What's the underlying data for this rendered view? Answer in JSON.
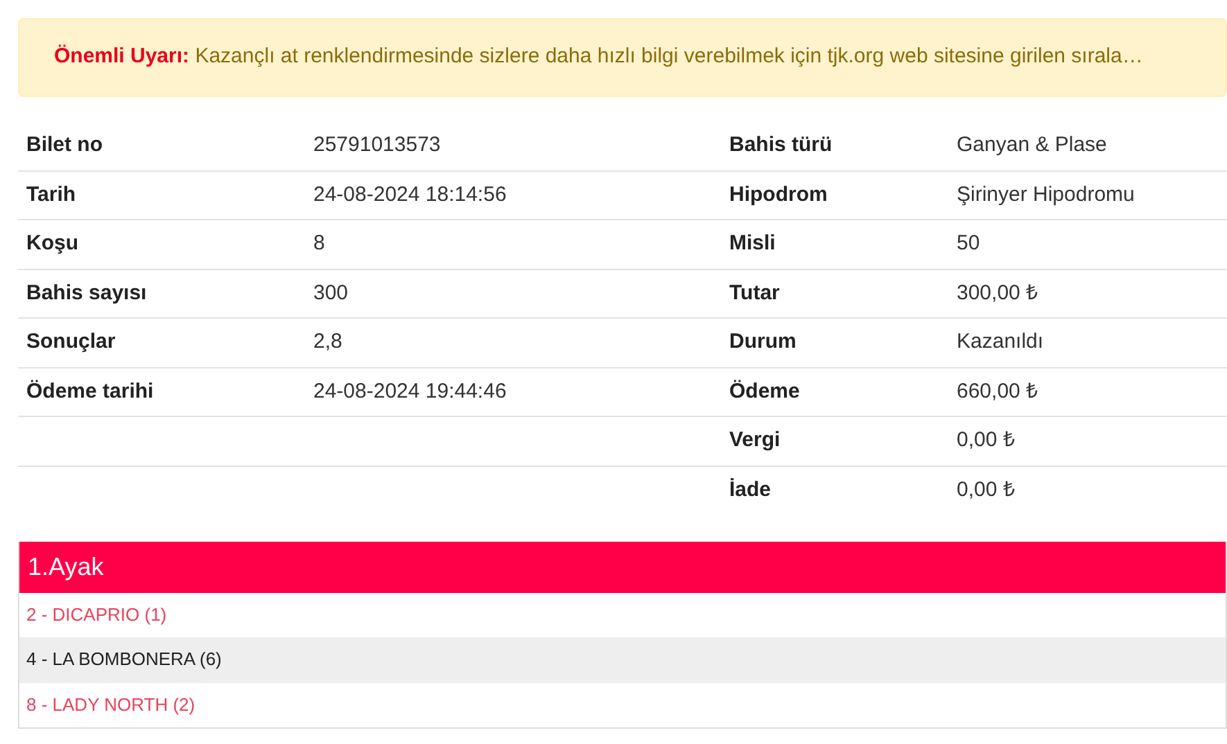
{
  "alert": {
    "label": "Önemli Uyarı:",
    "text": "Kazançlı at renklendirmesinde sizlere daha hızlı bilgi verebilmek için tjk.org web sitesine girilen sırala…"
  },
  "details": [
    {
      "left_label": "Bilet no",
      "left_value": "25791013573",
      "right_label": "Bahis türü",
      "right_value": "Ganyan & Plase"
    },
    {
      "left_label": "Tarih",
      "left_value": "24-08-2024 18:14:56",
      "right_label": "Hipodrom",
      "right_value": "Şirinyer Hipodromu"
    },
    {
      "left_label": "Koşu",
      "left_value": "8",
      "right_label": "Misli",
      "right_value": "50"
    },
    {
      "left_label": "Bahis sayısı",
      "left_value": "300",
      "right_label": "Tutar",
      "right_value": "300,00 ₺"
    },
    {
      "left_label": "Sonuçlar",
      "left_value": "2,8",
      "right_label": "Durum",
      "right_value": "Kazanıldı"
    },
    {
      "left_label": "Ödeme tarihi",
      "left_value": "24-08-2024 19:44:46",
      "right_label": "Ödeme",
      "right_value": "660,00 ₺"
    },
    {
      "right_label": "Vergi",
      "right_value": "0,00 ₺"
    },
    {
      "right_label": "İade",
      "right_value": "0,00 ₺"
    }
  ],
  "leg": {
    "title": "1.Ayak",
    "horses": [
      {
        "label": "2 - DICAPRIO (1)",
        "won": true
      },
      {
        "label": "4 - LA BOMBONERA (6)",
        "won": false
      },
      {
        "label": "8 - LADY NORTH (2)",
        "won": true
      }
    ]
  }
}
